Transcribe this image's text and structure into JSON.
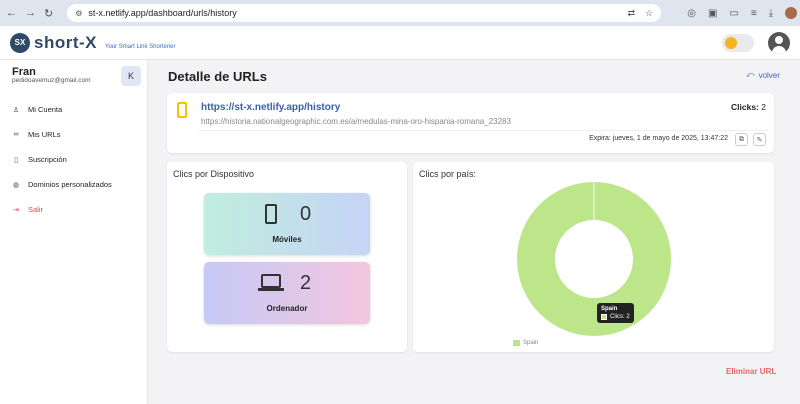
{
  "browser": {
    "url": "st-x.netlify.app/dashboard/urls/history"
  },
  "app": {
    "logo_mark": "SX",
    "name": "short-X",
    "tagline": "Your Smart Link Shortener"
  },
  "user": {
    "name": "Fran",
    "email": "pedidoavemuz@gmail.com"
  },
  "sidebar": {
    "collapse_label": "K",
    "items": [
      {
        "label": "Mi Cuenta",
        "icon": "user-icon"
      },
      {
        "label": "Mis URLs",
        "icon": "link-icon"
      },
      {
        "label": "Suscripción",
        "icon": "bookmark-icon"
      },
      {
        "label": "Dominios personalizados",
        "icon": "globe-icon"
      },
      {
        "label": "Salir",
        "icon": "logout-icon"
      }
    ]
  },
  "main": {
    "title": "Detalle de URLs",
    "back_label": "volver",
    "url_card": {
      "short_url": "https://st-x.netlify.app/history",
      "long_url": "https://historia.nationalgeographic.com.es/a/medulas-mina-oro-hispania-romana_23283",
      "clicks_label": "Clicks:",
      "clicks_value": "2",
      "expiry": "Expira: jueves, 1 de mayo de 2025, 13:47:22"
    },
    "device_card": {
      "title": "Clics por Dispositivo",
      "mobile": {
        "count": "0",
        "label": "Móviles"
      },
      "desktop": {
        "count": "2",
        "label": "Ordenador"
      }
    },
    "country_card": {
      "title": "Clics por país:",
      "tooltip_title": "Spain",
      "tooltip_value": "Clics: 2"
    },
    "delete_label": "Eliminar URL"
  },
  "colors": {
    "accent": "#3b5fa8",
    "donut": "#bde68a",
    "danger": "#e56767"
  },
  "chart_data": {
    "type": "pie",
    "categories": [
      "Spain"
    ],
    "values": [
      2
    ],
    "legend": "bottom"
  }
}
